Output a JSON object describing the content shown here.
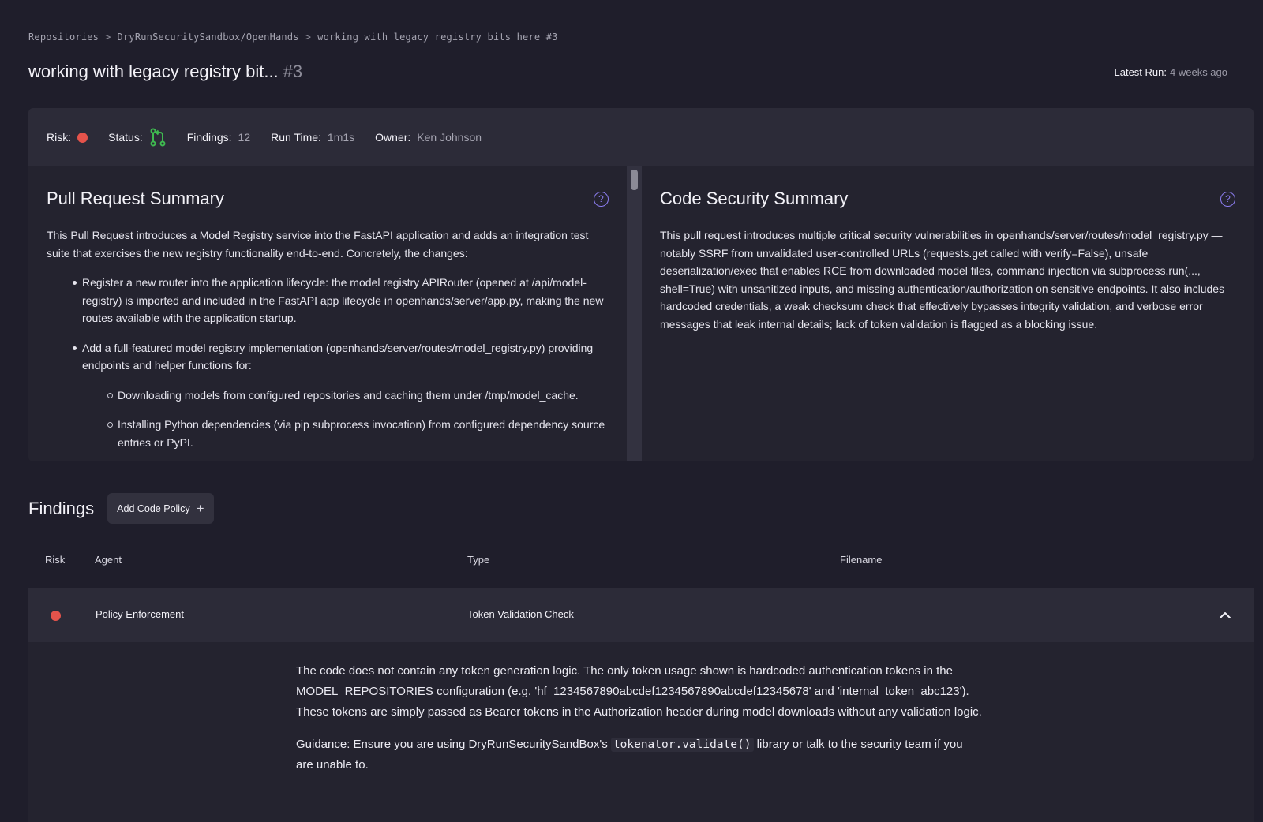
{
  "breadcrumb": {
    "items": [
      "Repositories",
      "DryRunSecuritySandbox/OpenHands",
      "working with legacy registry bits here #3"
    ],
    "separator": ">"
  },
  "header": {
    "title": "working with legacy registry bit...",
    "number": "#3",
    "latest_run_label": "Latest Run:",
    "latest_run_value": "4 weeks ago"
  },
  "meta": {
    "risk_label": "Risk:",
    "risk_color": "#e5534b",
    "status_label": "Status:",
    "status_icon": "git-pull-request-icon",
    "status_color": "#3fb950",
    "findings_label": "Findings:",
    "findings_value": "12",
    "runtime_label": "Run Time:",
    "runtime_value": "1m1s",
    "owner_label": "Owner:",
    "owner_value": "Ken Johnson"
  },
  "pr_summary": {
    "title": "Pull Request Summary",
    "intro": "This Pull Request introduces a Model Registry service into the FastAPI application and adds an integration test suite that exercises the new registry functionality end-to-end. Concretely, the changes:",
    "bullets": [
      "Register a new router into the application lifecycle: the model registry APIRouter (opened at /api/model-registry) is imported and included in the FastAPI app lifecycle in openhands/server/app.py, making the new routes available with the application startup.",
      "Add a full-featured model registry implementation (openhands/server/routes/model_registry.py) providing endpoints and helper functions for:"
    ],
    "sub_bullets": [
      "Downloading models from configured repositories and caching them under /tmp/model_cache.",
      "Installing Python dependencies (via pip subprocess invocation) from configured dependency source entries or PyPI."
    ]
  },
  "code_summary": {
    "title": "Code Security Summary",
    "text": "This pull request introduces multiple critical security vulnerabilities in openhands/server/routes/model_registry.py — notably SSRF from unvalidated user-controlled URLs (requests.get called with verify=False), unsafe deserialization/exec that enables RCE from downloaded model files, command injection via subprocess.run(..., shell=True) with unsanitized inputs, and missing authentication/authorization on sensitive endpoints. It also includes hardcoded credentials, a weak checksum check that effectively bypasses integrity validation, and verbose error messages that leak internal details; lack of token validation is flagged as a blocking issue."
  },
  "findings": {
    "title": "Findings",
    "add_policy_label": "Add Code Policy",
    "columns": [
      "Risk",
      "Agent",
      "Type",
      "Filename"
    ],
    "rows": [
      {
        "risk_color": "#e5534b",
        "agent": "Policy Enforcement",
        "type": "Token Validation Check",
        "filename": ""
      }
    ],
    "detail": {
      "paragraph": "The code does not contain any token generation logic. The only token usage shown is hardcoded authentication tokens in the MODEL_REPOSITORIES configuration (e.g. 'hf_1234567890abcdef1234567890abcdef12345678' and 'internal_token_abc123'). These tokens are simply passed as Bearer tokens in the Authorization header during model downloads without any validation logic.",
      "guidance_prefix": "Guidance: Ensure you are using DryRunSecuritySandBox's ",
      "guidance_code": "tokenator.validate()",
      "guidance_suffix": " library or talk to the security team if you are unable to."
    }
  }
}
